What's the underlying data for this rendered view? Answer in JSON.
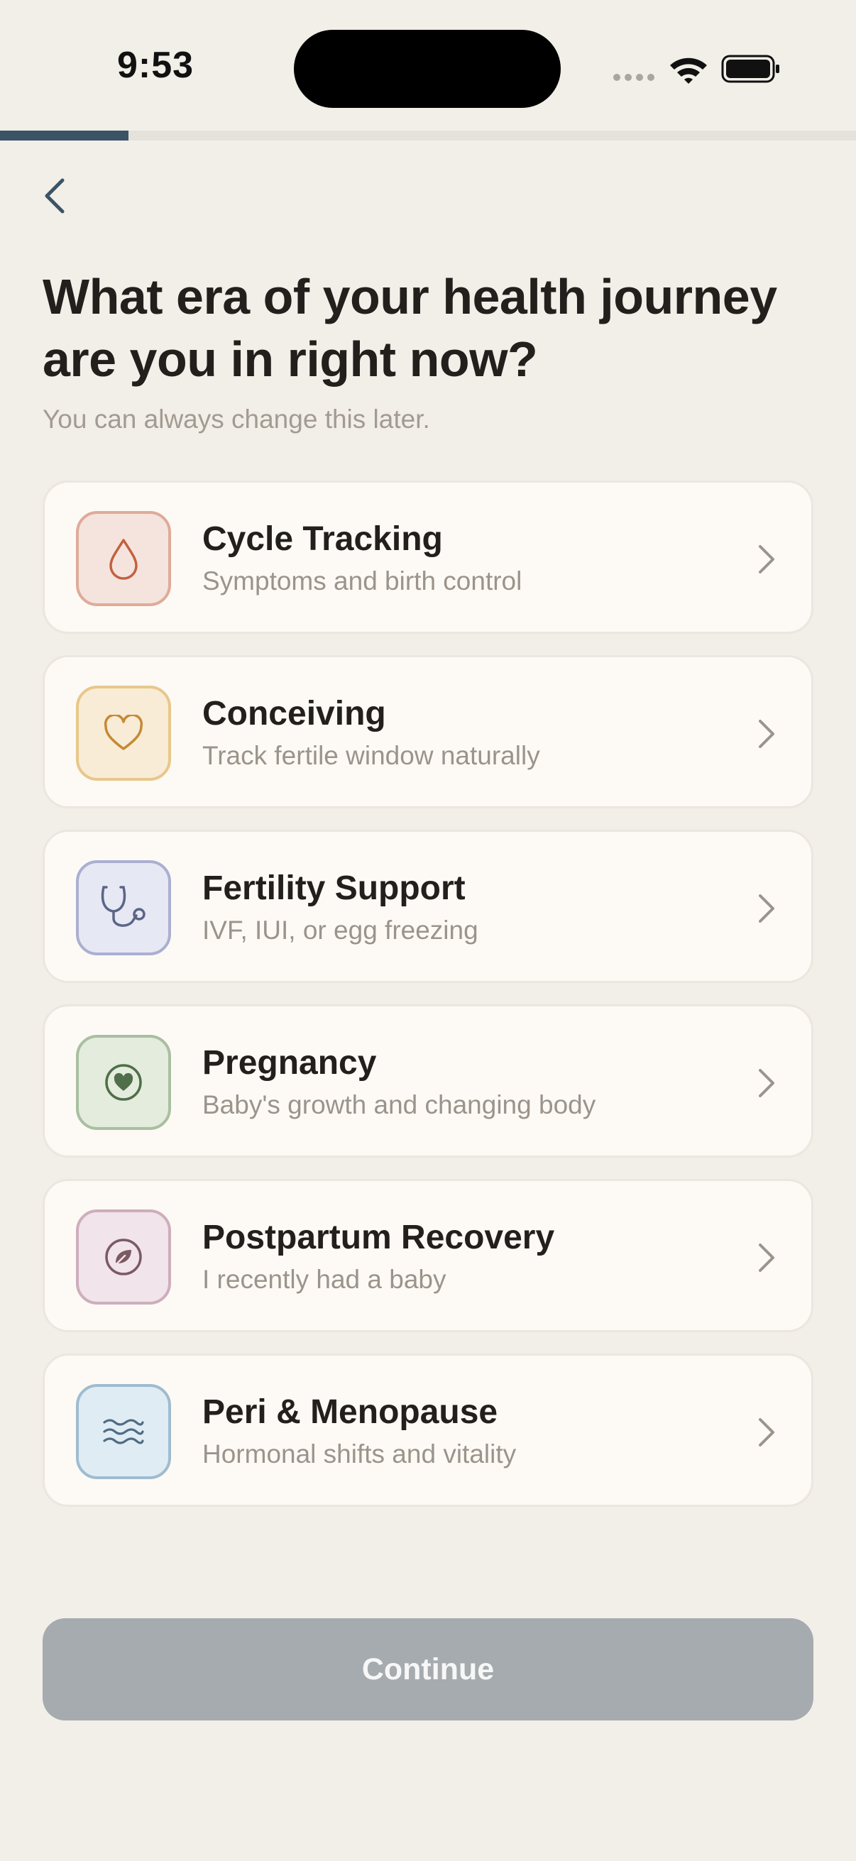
{
  "status_bar": {
    "time": "9:53"
  },
  "progress": {
    "fraction": 0.15,
    "color": "#3b5366"
  },
  "header": {
    "title": "What era of your health journey are you in right now?",
    "subtitle": "You can always change this later."
  },
  "options": [
    {
      "title": "Cycle Tracking",
      "description": "Symptoms and birth control",
      "icon": "droplet-icon",
      "bg": "#f5e4dd",
      "border": "#dfab9a",
      "color": "#c2613f"
    },
    {
      "title": "Conceiving",
      "description": "Track fertile window naturally",
      "icon": "heart-icon",
      "bg": "#f8ecd6",
      "border": "#e8c78c",
      "color": "#c58a35"
    },
    {
      "title": "Fertility Support",
      "description": "IVF, IUI, or egg freezing",
      "icon": "stethoscope-icon",
      "bg": "#e6e8f4",
      "border": "#abafd1",
      "color": "#5c6586"
    },
    {
      "title": "Pregnancy",
      "description": "Baby's growth and changing body",
      "icon": "heart-circle-icon",
      "bg": "#e3ecdd",
      "border": "#a9bfa1",
      "color": "#4f6e49"
    },
    {
      "title": "Postpartum Recovery",
      "description": "I recently had a baby",
      "icon": "leaf-icon",
      "bg": "#f1e4ea",
      "border": "#cdaebc",
      "color": "#7a5a63"
    },
    {
      "title": "Peri & Menopause",
      "description": "Hormonal shifts and vitality",
      "icon": "waves-icon",
      "bg": "#e0ecf4",
      "border": "#9fbcd0",
      "color": "#4f6c82"
    }
  ],
  "footer": {
    "continue_label": "Continue"
  }
}
